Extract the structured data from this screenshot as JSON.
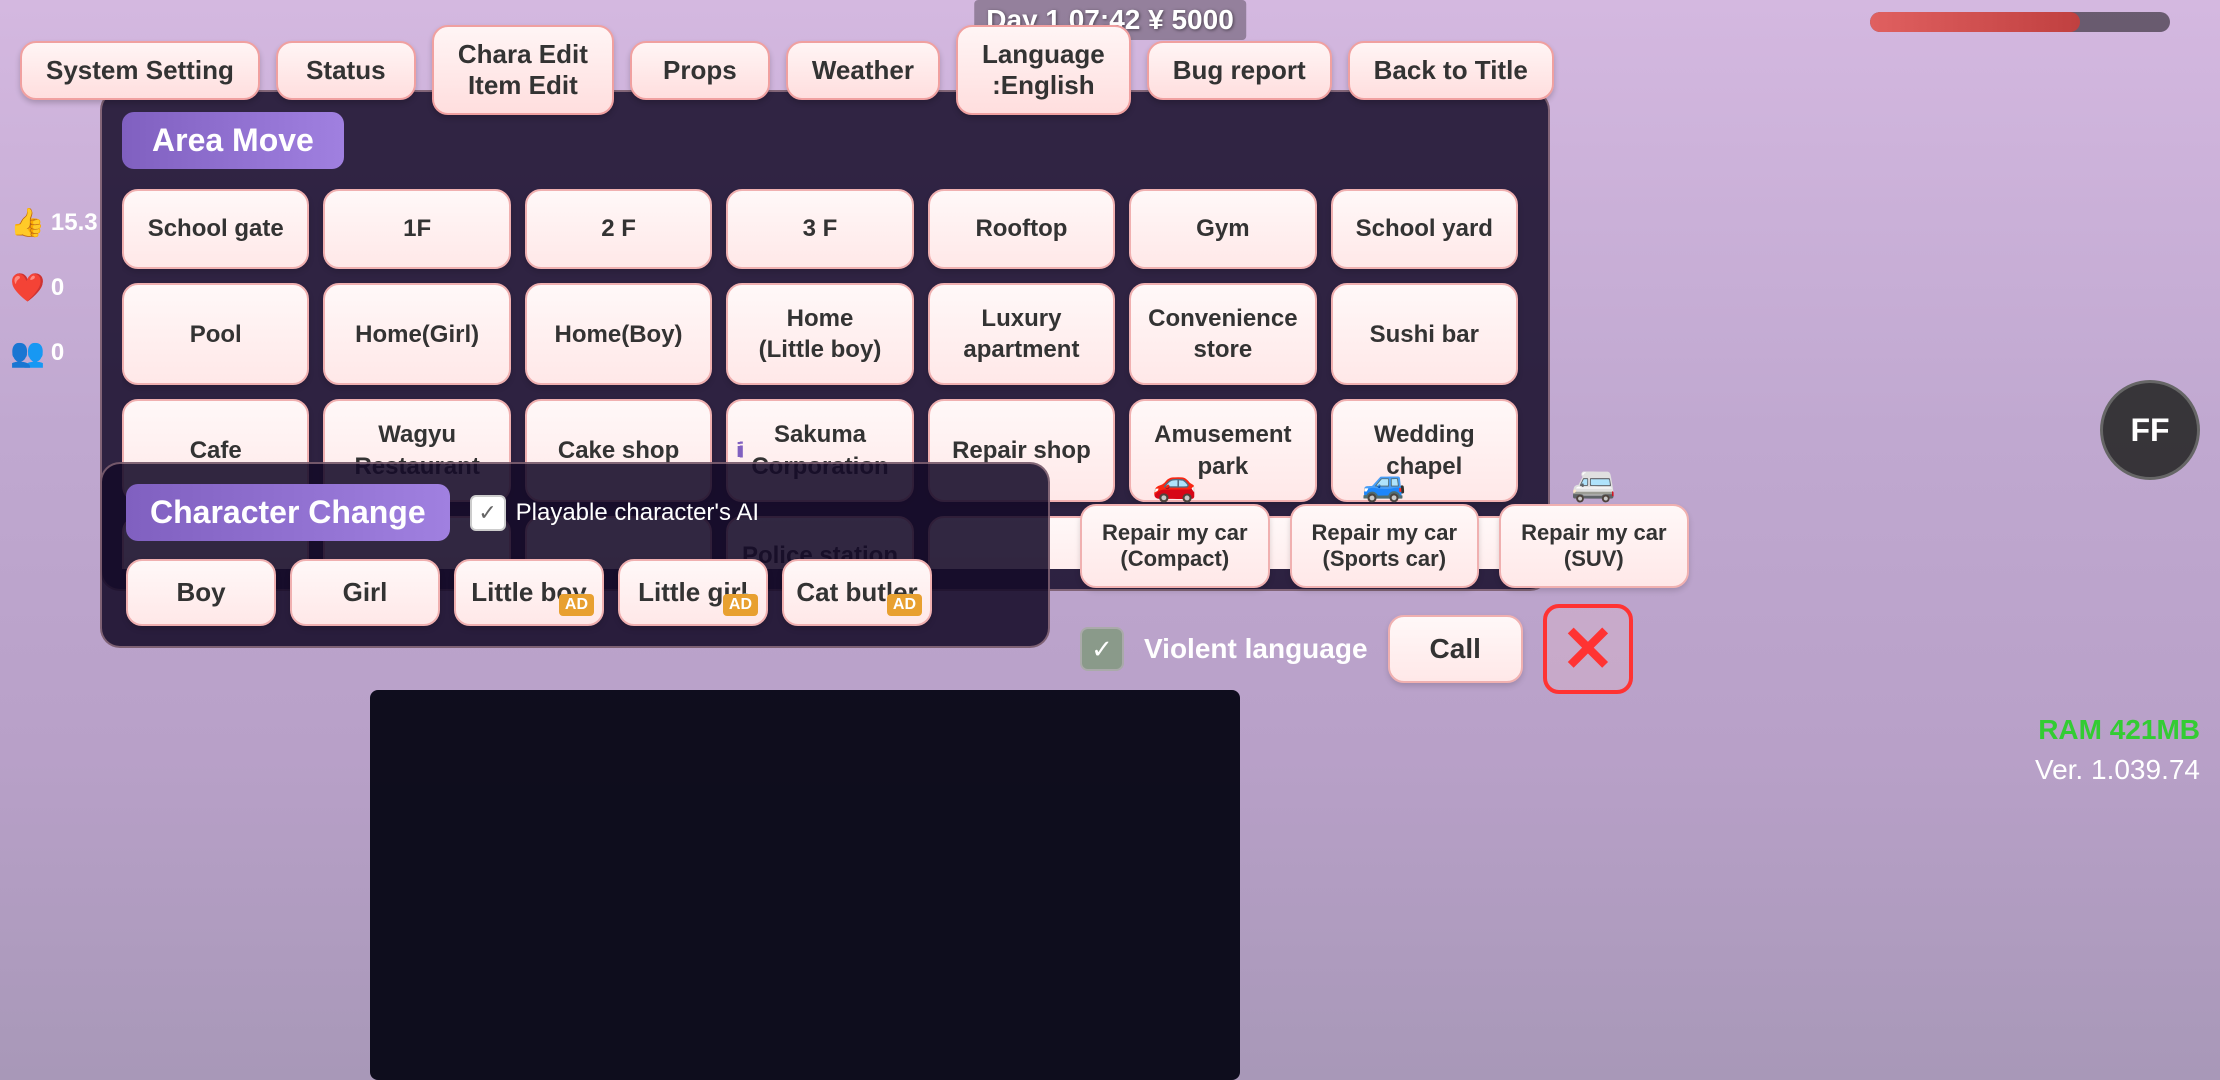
{
  "topbar": {
    "day_info": "Day 1  07:42  ¥ 5000",
    "buttons": [
      {
        "id": "system-setting",
        "label": "System Setting"
      },
      {
        "id": "status",
        "label": "Status"
      },
      {
        "id": "chara-edit",
        "label": "Chara Edit\nItem Edit"
      },
      {
        "id": "props",
        "label": "Props"
      },
      {
        "id": "weather",
        "label": "Weather"
      },
      {
        "id": "language",
        "label": "Language\n:English"
      },
      {
        "id": "bug-report",
        "label": "Bug report"
      },
      {
        "id": "back-to-title",
        "label": "Back to Title"
      }
    ]
  },
  "area_move": {
    "title": "Area Move",
    "locations": [
      "School gate",
      "1F",
      "2 F",
      "3 F",
      "Rooftop",
      "Gym",
      "School yard",
      "Pool",
      "Home(Girl)",
      "Home(Boy)",
      "Home\n(Little boy)",
      "Luxury\napartment",
      "Convenience\nstore",
      "Sushi bar",
      "Cafe",
      "Wagyu\nRestaurant",
      "Cake shop",
      "Sakuma\nCorporation",
      "Repair shop",
      "Amusement\npark",
      "Wedding\nchapel",
      "",
      "",
      "",
      "Police station",
      "",
      "",
      ""
    ]
  },
  "character_change": {
    "title": "Character Change",
    "ai_label": "Playable character's AI",
    "ai_checked": true,
    "characters": [
      {
        "id": "boy",
        "label": "Boy",
        "locked": false,
        "ad": false
      },
      {
        "id": "girl",
        "label": "Girl",
        "locked": false,
        "ad": false
      },
      {
        "id": "little-boy",
        "label": "Little boy",
        "locked": true,
        "ad": true
      },
      {
        "id": "little-girl",
        "label": "Little girl",
        "locked": true,
        "ad": true
      },
      {
        "id": "cat-butler",
        "label": "Cat butler",
        "locked": true,
        "ad": true
      }
    ]
  },
  "repair_cars": [
    {
      "id": "compact",
      "label": "Repair my car\n(Compact)",
      "icon_color": "#cc3333"
    },
    {
      "id": "sports",
      "label": "Repair my car\n(Sports car)",
      "icon_color": "#3366cc"
    },
    {
      "id": "suv",
      "label": "Repair my car\n(SUV)",
      "icon_color": "#999999"
    }
  ],
  "violent_language": {
    "label": "Violent language",
    "checked": true
  },
  "call_btn": "Call",
  "close_btn": "×",
  "ram_info": "RAM 421MB",
  "ver_info": "Ver. 1.039.74",
  "ff_btn": "FF",
  "social": {
    "likes": "15.3",
    "hearts": "0",
    "people": "0"
  }
}
